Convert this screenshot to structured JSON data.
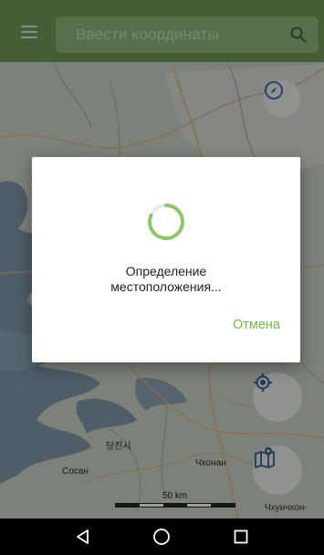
{
  "toolbar": {
    "menu_icon": "hamburger-menu-icon",
    "search_placeholder": "Ввести координаты",
    "search_icon": "search-icon",
    "background": "#6f9a59"
  },
  "map": {
    "labels": {
      "dangjin": "당진시",
      "sosan": "Сосан",
      "chhonan": "Чхонан",
      "chhunchhon": "Чхунчхон-"
    },
    "scale_label": "50 km",
    "buttons": {
      "compass": "compass-icon",
      "locate": "my-location-icon",
      "map_marker": "map-marker-icon"
    }
  },
  "dialog": {
    "message_line1": "Определение",
    "message_line2": "местоположения...",
    "cancel_label": "Отмена",
    "accent": "#74b84a"
  },
  "navbar": {
    "back": "back-triangle-icon",
    "home": "home-circle-icon",
    "recents": "recents-square-icon"
  }
}
